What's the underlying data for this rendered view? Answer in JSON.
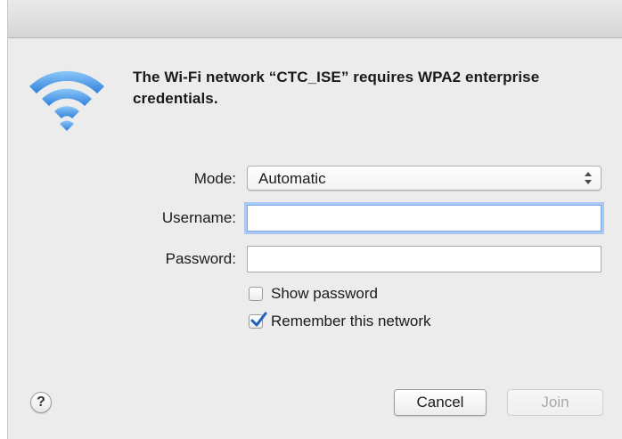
{
  "dialog": {
    "message": "The Wi-Fi network “CTC_ISE” requires WPA2 enterprise credentials.",
    "icon": "wifi-icon"
  },
  "form": {
    "mode_label": "Mode:",
    "mode_value": "Automatic",
    "username_label": "Username:",
    "username_value": "",
    "password_label": "Password:",
    "password_value": ""
  },
  "options": {
    "show_password_label": "Show password",
    "show_password_checked": false,
    "remember_label": "Remember this network",
    "remember_checked": true
  },
  "buttons": {
    "help": "?",
    "cancel": "Cancel",
    "join": "Join",
    "join_enabled": false
  },
  "colors": {
    "wifi_blue": "#4a9ae8",
    "focus_ring": "#a9c8f3",
    "checkmark": "#1f5fbf"
  }
}
